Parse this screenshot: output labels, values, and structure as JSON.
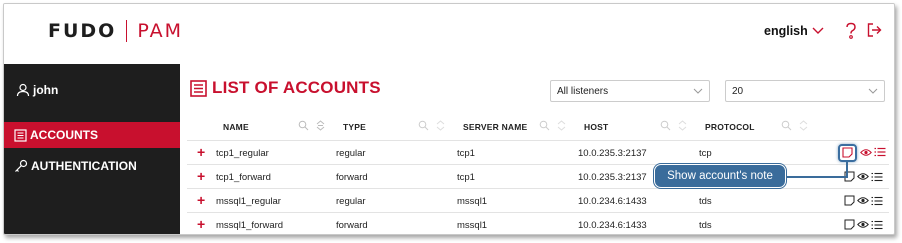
{
  "header": {
    "logo_left": "FUDO",
    "logo_right": "PAM",
    "language": "english"
  },
  "sidebar": {
    "user": "john",
    "items": [
      {
        "label": "ACCOUNTS",
        "active": true
      },
      {
        "label": "AUTHENTICATION",
        "active": false
      }
    ]
  },
  "page": {
    "title": "LIST OF ACCOUNTS",
    "listener_filter": "All listeners",
    "page_size": "20"
  },
  "table": {
    "columns": [
      "NAME",
      "TYPE",
      "SERVER NAME",
      "HOST",
      "PROTOCOL"
    ],
    "rows": [
      {
        "name": "tcp1_regular",
        "type": "regular",
        "server": "tcp1",
        "host": "10.0.235.3:2137",
        "protocol": "tcp"
      },
      {
        "name": "tcp1_forward",
        "type": "forward",
        "server": "tcp1",
        "host": "10.0.235.3:2137",
        "protocol": "tcp"
      },
      {
        "name": "mssql1_regular",
        "type": "regular",
        "server": "mssql1",
        "host": "10.0.234.6:1433",
        "protocol": "tds"
      },
      {
        "name": "mssql1_forward",
        "type": "forward",
        "server": "mssql1",
        "host": "10.0.234.6:1433",
        "protocol": "tds"
      }
    ]
  },
  "tooltip": {
    "text": "Show account's note"
  },
  "colors": {
    "brand_red": "#c8102e",
    "sidebar_bg": "#1e1e1e",
    "callout_blue": "#3a6c9b"
  }
}
